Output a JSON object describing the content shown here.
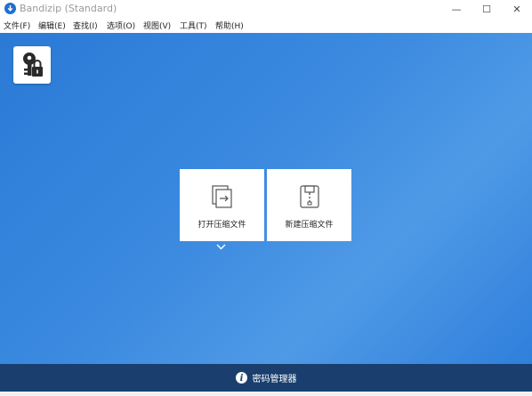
{
  "window": {
    "title": "Bandizip (Standard)",
    "minimize": "—",
    "maximize": "☐",
    "close": "✕"
  },
  "menu": [
    {
      "label": "文件(F)"
    },
    {
      "label": "编辑(E)"
    },
    {
      "label": "查找(I)"
    },
    {
      "label": "选项(O)"
    },
    {
      "label": "视图(V)"
    },
    {
      "label": "工具(T)"
    },
    {
      "label": "帮助(H)"
    }
  ],
  "main": {
    "key_button_icon": "key-lock-icon",
    "cards": [
      {
        "label": "打开压缩文件",
        "icon": "open-archive-icon"
      },
      {
        "label": "新建压缩文件",
        "icon": "new-archive-icon"
      }
    ],
    "expand_icon": "chevron-down-icon"
  },
  "footer": {
    "label": "密码管理器",
    "icon": "info-icon"
  },
  "colors": {
    "main_bg": "#3b8ae0",
    "footer_bg": "#1a3f6e",
    "accent": "#1f6fd0"
  }
}
